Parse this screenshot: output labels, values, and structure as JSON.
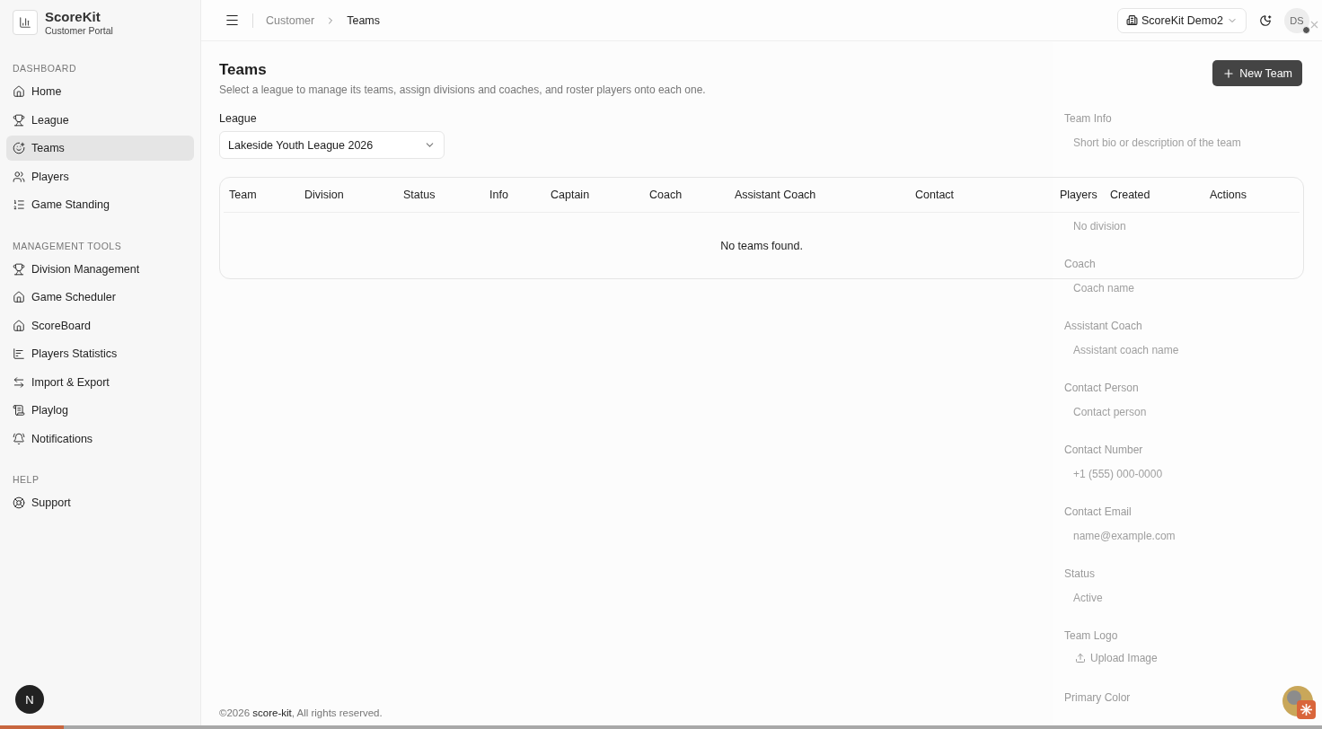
{
  "brand": {
    "name": "ScoreKit",
    "subtitle": "Customer Portal"
  },
  "sidebar": {
    "sections": [
      {
        "title": "DASHBOARD",
        "items": [
          {
            "label": "Home",
            "selected": false
          },
          {
            "label": "League",
            "selected": false
          },
          {
            "label": "Teams",
            "selected": true
          },
          {
            "label": "Players",
            "selected": false
          },
          {
            "label": "Game Standing",
            "selected": false
          }
        ]
      },
      {
        "title": "MANAGEMENT TOOLS",
        "items": [
          {
            "label": "Division Management",
            "selected": false
          },
          {
            "label": "Game Scheduler",
            "selected": false
          },
          {
            "label": "ScoreBoard",
            "selected": false
          },
          {
            "label": "Players Statistics",
            "selected": false
          },
          {
            "label": "Import & Export",
            "selected": false
          },
          {
            "label": "Playlog",
            "selected": false
          },
          {
            "label": "Notifications",
            "selected": false
          }
        ]
      },
      {
        "title": "HELP",
        "items": [
          {
            "label": "Support",
            "selected": false
          }
        ]
      }
    ],
    "dev_badge": "N"
  },
  "header": {
    "breadcrumb": [
      "Customer",
      "Teams"
    ],
    "org_switcher": "ScoreKit Demo2",
    "avatar": "DS"
  },
  "page": {
    "title": "Teams",
    "description": "Select a league to manage its teams, assign divisions and coaches, and roster players onto each one.",
    "new_button": "New Team",
    "league_label": "League",
    "league_value": "Lakeside Youth League 2026"
  },
  "table": {
    "columns": [
      "Team",
      "Division",
      "Status",
      "Info",
      "Captain",
      "Coach",
      "Assistant Coach",
      "Contact",
      "Players",
      "Created",
      "Actions"
    ],
    "empty_message": "No teams found."
  },
  "sheet": {
    "fields": [
      {
        "kind": "textarea",
        "label": "Team Info",
        "placeholder": "Short bio or description of the team"
      },
      {
        "kind": "select",
        "value": "No division"
      },
      {
        "kind": "input",
        "label": "Coach",
        "placeholder": "Coach name"
      },
      {
        "kind": "input",
        "label": "Assistant Coach",
        "placeholder": "Assistant coach name"
      },
      {
        "kind": "input",
        "label": "Contact Person",
        "placeholder": "Contact person"
      },
      {
        "kind": "input",
        "label": "Contact Number",
        "placeholder": "+1 (555) 000-0000"
      },
      {
        "kind": "input",
        "label": "Contact Email",
        "placeholder": "name@example.com"
      },
      {
        "kind": "select",
        "label": "Status",
        "value": "Active"
      },
      {
        "kind": "upload",
        "label": "Team Logo",
        "button": "Upload Image"
      },
      {
        "kind": "color",
        "label": "Primary Color"
      }
    ]
  },
  "footer": "©2026 **score-kit**, All rights reserved.",
  "progress": {
    "level": 0.048
  }
}
